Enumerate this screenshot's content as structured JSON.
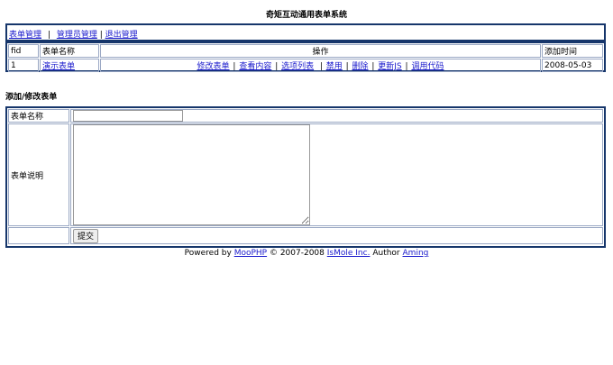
{
  "title": "奇矩互动通用表单系统",
  "nav": {
    "forms": "表单管理",
    "admins": "管理员管理",
    "logout": "退出管理"
  },
  "list": {
    "headers": [
      "fid",
      "表单名称",
      "操作",
      "添加时间"
    ],
    "rows": [
      {
        "fid": "1",
        "name": "演示表单",
        "ops": [
          "修改表单",
          "查看内容",
          "选项列表",
          "禁用",
          "删除",
          "更新JS",
          "调用代码"
        ],
        "date": "2008-05-03"
      }
    ]
  },
  "section_title": "添加/修改表单",
  "form": {
    "name_label": "表单名称",
    "name_value": "",
    "desc_label": "表单说明",
    "desc_value": "",
    "submit_label": "提交"
  },
  "footer": {
    "prefix": "Powered by",
    "product": "MooPHP",
    "copyright": "© 2007-2008",
    "company": "IsMole Inc.",
    "author_label": "Author",
    "author": "Aming"
  },
  "colors": {
    "border": "#16366b",
    "link": "#1a1acc"
  }
}
